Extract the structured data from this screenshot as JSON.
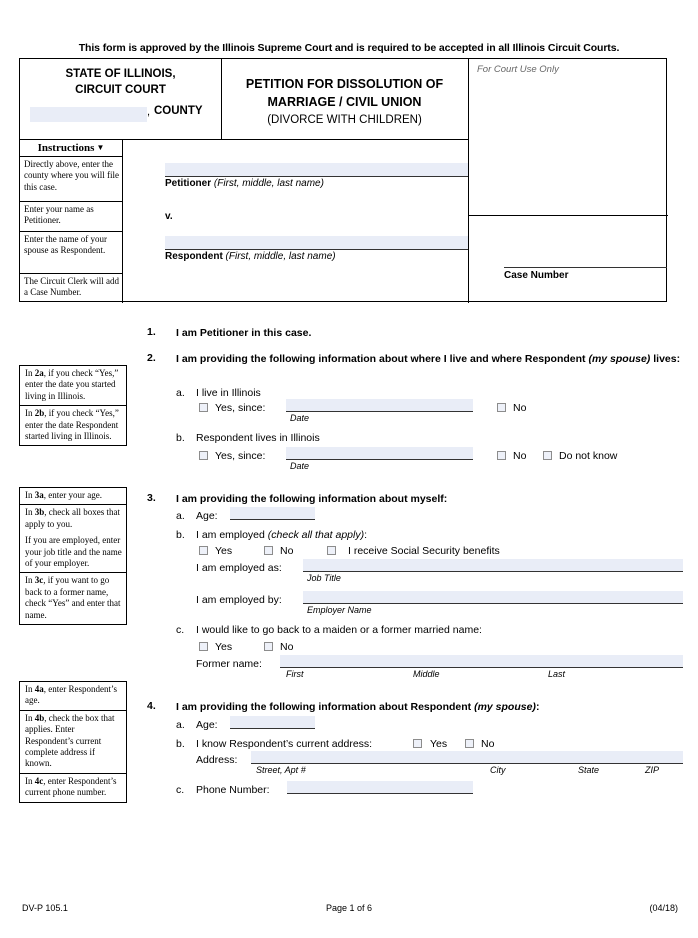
{
  "approval_line": "This form is approved by the Illinois Supreme Court and is required to be accepted in all Illinois Circuit Courts.",
  "caption": {
    "state_title_line1": "STATE OF ILLINOIS,",
    "state_title_line2": "CIRCUIT COURT",
    "county_comma": ",",
    "county_word": "COUNTY",
    "county_value": "",
    "doc_title_line1": "PETITION FOR DISSOLUTION OF",
    "doc_title_line2": "MARRIAGE / CIVIL UNION",
    "doc_subtitle": "(DIVORCE WITH CHILDREN)",
    "court_use_only": "For Court Use Only",
    "petitioner_label_bold": "Petitioner",
    "petitioner_label_ital": " (First, middle, last name)",
    "petitioner_value": "",
    "versus": "v.",
    "respondent_label_bold": "Respondent",
    "respondent_label_ital": " (First, middle, last name)",
    "respondent_value": "",
    "case_number_label": "Case Number",
    "case_number_value": ""
  },
  "instructions": {
    "header": "Instructions",
    "caret": "▼",
    "cells": [
      "Directly above, enter the county where you will file this case.",
      "Enter your name as Petitioner.",
      "Enter the name of your spouse as Respondent.",
      "The Circuit Clerk will add a Case Number."
    ]
  },
  "side_notes": {
    "group1": [
      [
        "In ",
        "2a",
        ", if you check “Yes,” enter the date you started living in Illinois."
      ],
      [
        "In ",
        "2b",
        ", if you check “Yes,” enter the date Respondent started living in Illinois."
      ]
    ],
    "group2_a": [
      [
        "In ",
        "3a",
        ", enter your age."
      ]
    ],
    "group2_b_p1": [
      "In ",
      "3b",
      ", check all boxes that apply to you."
    ],
    "group2_b_p2": "If you are employed, enter your job title and the name of your employer.",
    "group2_c": [
      [
        "In ",
        "3c",
        ", if you want to go back to a former name, check “Yes” and enter that name."
      ]
    ],
    "group3": [
      [
        "In ",
        "4a",
        ", enter Respondent’s age."
      ],
      [
        "In ",
        "4b",
        ", check the box that applies. Enter Respondent’s current complete address if known."
      ],
      [
        "In ",
        "4c",
        ", enter Respondent’s current phone number."
      ]
    ]
  },
  "item1": {
    "number": "1.",
    "text": "I am Petitioner in this case."
  },
  "item2": {
    "number": "2.",
    "text_bold_1": "I am providing the following information about where I live and where Respondent ",
    "text_ital": "(my spouse)",
    "text_bold_2": " lives:",
    "a_letter": "a.",
    "a_text": "I live in Illinois",
    "a_yes": "Yes, since:",
    "a_date_label": "Date",
    "a_date_value": "",
    "a_no": "No",
    "b_letter": "b.",
    "b_text": "Respondent lives in Illinois",
    "b_yes": "Yes, since:",
    "b_date_label": "Date",
    "b_date_value": "",
    "b_no": "No",
    "b_dontknow": "Do not know"
  },
  "item3": {
    "number": "3.",
    "text": "I am providing the following information about myself:",
    "a_letter": "a.",
    "a_label": "Age:",
    "a_value": "",
    "b_letter": "b.",
    "b_label_bold": "I am employed ",
    "b_label_ital": "(check all that apply)",
    "b_label_colon": ":",
    "b_yes": "Yes",
    "b_no": "No",
    "b_ssi": "I receive Social Security benefits",
    "b_as_label": "I am employed as:",
    "b_as_value": "",
    "b_as_hint": "Job Title",
    "b_by_label": "I am employed by:",
    "b_by_value": "",
    "b_by_hint": "Employer Name",
    "c_letter": "c.",
    "c_text": "I would like to go back to a maiden or a former married name:",
    "c_yes": "Yes",
    "c_no": "No",
    "c_former_label": "Former name:",
    "c_former_value": "",
    "c_hint_first": "First",
    "c_hint_middle": "Middle",
    "c_hint_last": "Last"
  },
  "item4": {
    "number": "4.",
    "text_bold_1": "I am providing the following information about Respondent ",
    "text_ital": "(my spouse)",
    "text_bold_2": ":",
    "a_letter": "a.",
    "a_label": "Age:",
    "a_value": "",
    "b_letter": "b.",
    "b_text": "I know Respondent’s current address:",
    "b_yes": "Yes",
    "b_no": "No",
    "b_addr_label": "Address:",
    "b_addr_value": "",
    "b_hint_street": "Street, Apt #",
    "b_hint_city": "City",
    "b_hint_state": "State",
    "b_hint_zip": "ZIP",
    "c_letter": "c.",
    "c_label": "Phone Number:",
    "c_value": ""
  },
  "footer": {
    "form_id": "DV-P 105.1",
    "page": "Page 1 of 6",
    "revision": "(04/18)"
  }
}
